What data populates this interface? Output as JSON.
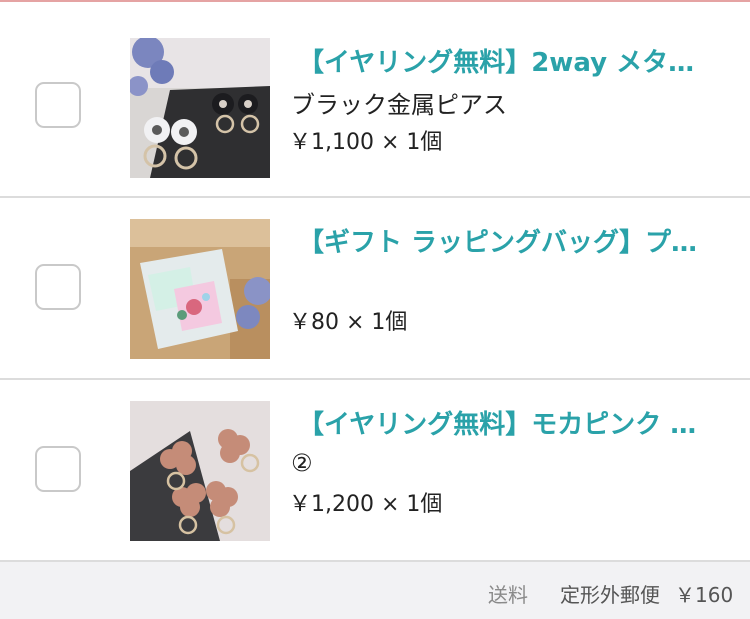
{
  "cart": {
    "items": [
      {
        "title": "【イヤリング無料】2way メタ…",
        "variant": "ブラック金属ピアス",
        "price": "￥1,100 × 1個",
        "image": "earrings-black-white-flower-photo"
      },
      {
        "title": "【ギフト ラッピングバッグ】プ…",
        "variant": "",
        "price": "￥80 × 1個",
        "image": "gift-wrapping-bag-photo"
      },
      {
        "title": "【イヤリング無料】モカピンク …",
        "variant": "②",
        "price": "￥1,200 × 1個",
        "image": "mocha-pink-flower-earrings-photo"
      }
    ]
  },
  "shipping": {
    "label": "送料",
    "method": "定形外郵便",
    "price": "￥160"
  },
  "colors": {
    "title": "#2aa2a9",
    "divider": "#dcdcdc",
    "top_rule": "#e5a3a3",
    "shipping_bg": "#f2f2f4"
  }
}
